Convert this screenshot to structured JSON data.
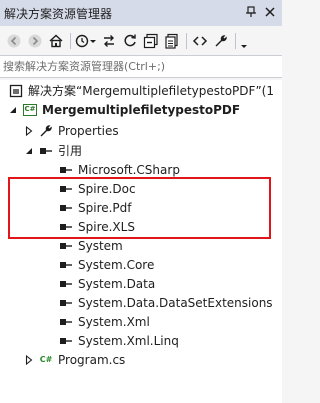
{
  "window": {
    "title": "解决方案资源管理器"
  },
  "search": {
    "placeholder": "搜索解决方案资源管理器(Ctrl+;)"
  },
  "tree": {
    "solution": "解决方案“MergemultiplefiletypestoPDF”(1",
    "project": "MergemultiplefiletypestoPDF",
    "properties": "Properties",
    "references": "引用",
    "reference_items": [
      "Microsoft.CSharp",
      "Spire.Doc",
      "Spire.Pdf",
      "Spire.XLS",
      "System",
      "System.Core",
      "System.Data",
      "System.Data.DataSetExtensions",
      "System.Xml",
      "System.Xml.Linq"
    ],
    "program_file": "Program.cs",
    "cs_badge": "C#",
    "cs_file_badge": "C#"
  },
  "colors": {
    "titlebar": "#d6dbe9",
    "highlight_border": "#e0161b",
    "tree_background": "#ffffff"
  }
}
